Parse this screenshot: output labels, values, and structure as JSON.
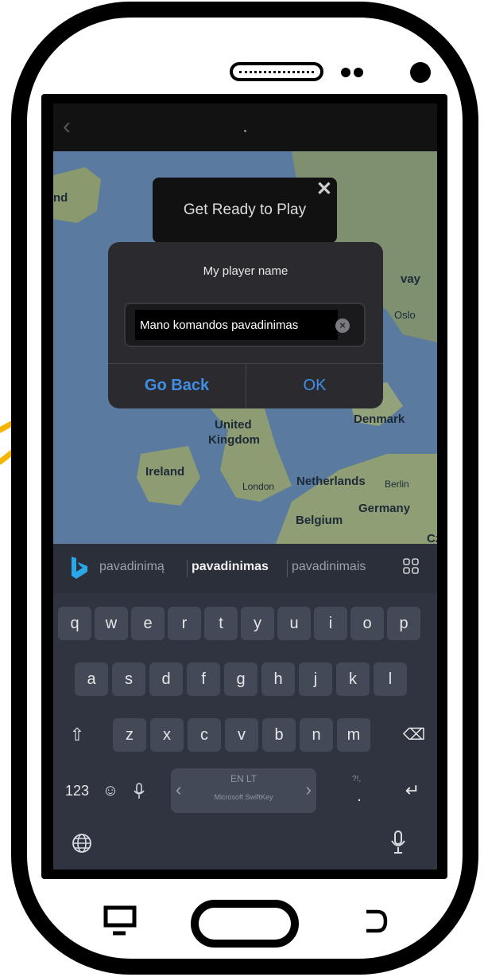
{
  "topbar": {
    "back_icon": "chevron-left-icon"
  },
  "map": {
    "labels": [
      {
        "text": "nd"
      },
      {
        "text": "vay"
      },
      {
        "text": "Oslo"
      },
      {
        "text": "Denmark"
      },
      {
        "text": "United"
      },
      {
        "text": "Kingdom"
      },
      {
        "text": "Ireland"
      },
      {
        "text": "London"
      },
      {
        "text": "Netherlands"
      },
      {
        "text": "Berlin"
      },
      {
        "text": "Germany"
      },
      {
        "text": "Belgium"
      },
      {
        "text": "Cz"
      }
    ]
  },
  "ready_popup": {
    "title": "Get Ready to Play",
    "close_icon": "close-icon"
  },
  "dialog": {
    "title": "My player name",
    "input_value": "Mano komandos pavadinimas",
    "go_back": "Go Back",
    "ok": "OK"
  },
  "keyboard": {
    "suggestions": [
      "pavadinimą",
      "pavadinimas",
      "pavadinimais"
    ],
    "row1": [
      "q",
      "w",
      "e",
      "r",
      "t",
      "y",
      "u",
      "i",
      "o",
      "p"
    ],
    "row2": [
      "a",
      "s",
      "d",
      "f",
      "g",
      "h",
      "j",
      "k",
      "l"
    ],
    "row3": [
      "z",
      "x",
      "c",
      "v",
      "b",
      "n",
      "m"
    ],
    "num_key": "123",
    "space_lang": "EN LT",
    "space_brand": "Microsoft SwiftKey",
    "punct_key": "?!,",
    "punct_dot": "."
  },
  "colors": {
    "accent": "#3f8fe6",
    "annotation_arrow": "#f5b400"
  }
}
